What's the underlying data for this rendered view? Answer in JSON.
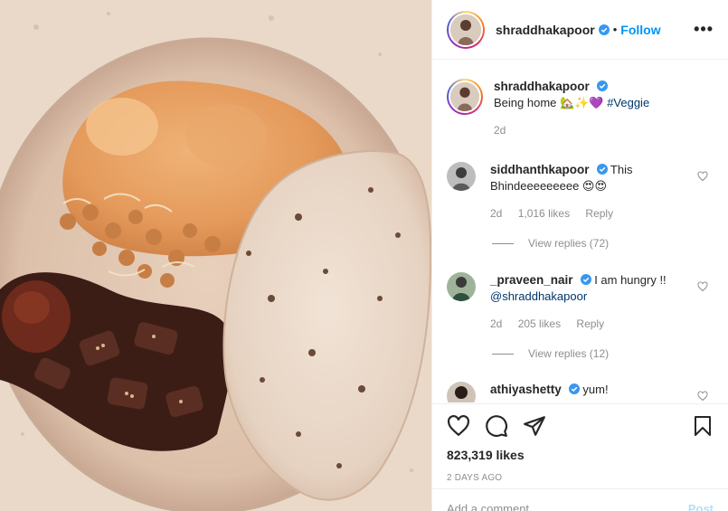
{
  "post": {
    "username": "shraddhakapoor",
    "follow_label": "Follow",
    "more_label": "•••",
    "caption_user": "shraddhakapoor",
    "caption_text": "Being home 🏡✨💜",
    "caption_tag": "#Veggie",
    "caption_time": "2d",
    "likes": "823,319 likes",
    "date": "2 DAYS AGO",
    "add_comment_placeholder": "Add a comment…",
    "post_label": "Post"
  },
  "comments": [
    {
      "user": "siddhanthkapoor",
      "text": "This Bhindeeeeeeeee 😍😍",
      "mention": "",
      "time": "2d",
      "likes": "1,016 likes",
      "reply": "Reply",
      "view_replies": "View replies (72)"
    },
    {
      "user": "_praveen_nair",
      "text": "I am hungry !!",
      "mention": "@shraddhakapoor",
      "time": "2d",
      "likes": "205 likes",
      "reply": "Reply",
      "view_replies": "View replies (12)"
    },
    {
      "user": "athiyashetty",
      "text": "yum!",
      "mention": ""
    }
  ],
  "colors": {
    "accent": "#0095f6",
    "verified": "#3897f0",
    "muted": "#8e8e8e",
    "text": "#262626"
  },
  "icons": [
    "heart-icon",
    "comment-icon",
    "share-icon",
    "bookmark-icon",
    "verified-icon",
    "more-icon"
  ]
}
